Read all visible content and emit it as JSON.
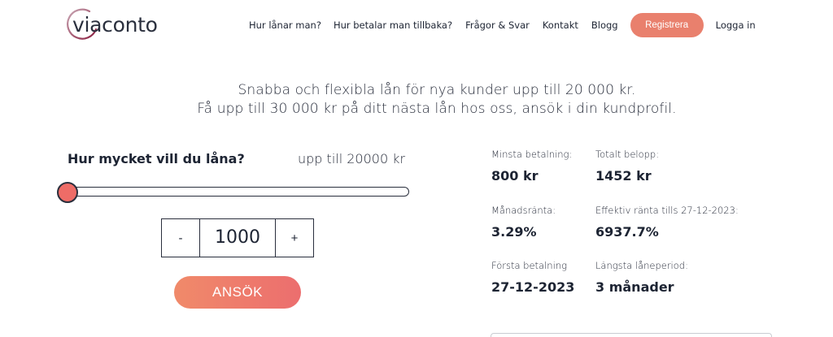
{
  "header": {
    "logo_text": "viaconto",
    "nav": [
      {
        "label": "Hur lånar man?"
      },
      {
        "label": "Hur betalar man tillbaka?"
      },
      {
        "label": "Frågor & Svar"
      },
      {
        "label": "Kontakt"
      },
      {
        "label": "Blogg"
      }
    ],
    "register_label": "Registrera",
    "login_label": "Logga in"
  },
  "tagline": {
    "line1": "Snabba och flexibla lån för nya kunder upp till 20 000 kr.",
    "line2": "Få upp till 30 000 kr på ditt nästa lån hos oss, ansök i din kundprofil."
  },
  "calculator": {
    "question": "Hur mycket vill du låna?",
    "max_text": "upp till 20000 kr",
    "slider_value_fraction": 0.0,
    "amount": "1000",
    "minus_label": "-",
    "plus_label": "+",
    "apply_label": "ANSÖK"
  },
  "stats": {
    "min_payment_label": "Minsta betalning:",
    "min_payment_value": "800 kr",
    "total_label": "Totalt belopp:",
    "total_value": "1452 kr",
    "monthly_rate_label": "Månadsränta:",
    "monthly_rate_value": "3.29%",
    "effective_rate_label": "Effektiv ränta tills 27-12-2023:",
    "effective_rate_value": "6937.7%",
    "first_payment_label": "Första betalning",
    "first_payment_value": "27-12-2023",
    "longest_period_label": "Längsta låneperiod:",
    "longest_period_value": "3 månader"
  },
  "colors": {
    "accent": "#e9806d",
    "slider_thumb": "#ee6c67",
    "text": "#1d2433"
  }
}
